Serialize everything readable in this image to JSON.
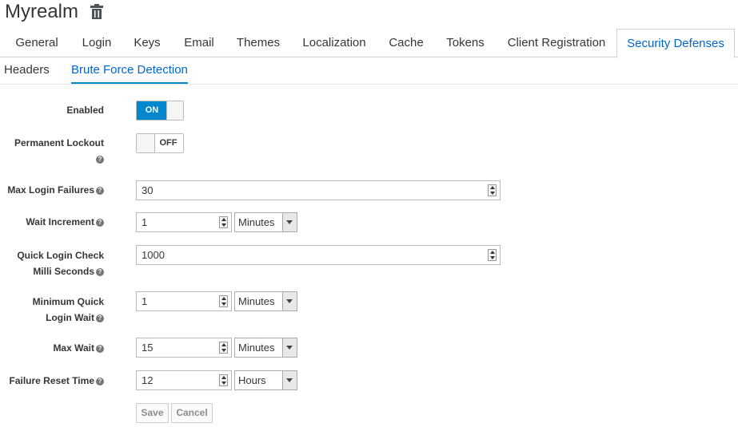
{
  "realm": {
    "title": "Myrealm",
    "delete_icon": "trash-icon"
  },
  "tabs": [
    {
      "label": "General"
    },
    {
      "label": "Login"
    },
    {
      "label": "Keys"
    },
    {
      "label": "Email"
    },
    {
      "label": "Themes"
    },
    {
      "label": "Localization"
    },
    {
      "label": "Cache"
    },
    {
      "label": "Tokens"
    },
    {
      "label": "Client Registration"
    },
    {
      "label": "Security Defenses",
      "active": true
    }
  ],
  "subtabs": [
    {
      "label": "Headers"
    },
    {
      "label": "Brute Force Detection",
      "active": true
    }
  ],
  "form": {
    "enabled": {
      "label": "Enabled",
      "state": "ON"
    },
    "permanent_lockout": {
      "label": "Permanent Lockout",
      "state": "OFF"
    },
    "max_login_failures": {
      "label": "Max Login Failures",
      "value": "30"
    },
    "wait_increment": {
      "label": "Wait Increment",
      "value": "1",
      "unit": "Minutes"
    },
    "quick_login_check": {
      "label_line1": "Quick Login Check",
      "label_line2": "Milli Seconds",
      "value": "1000"
    },
    "minimum_quick_login_wait": {
      "label_line1": "Minimum Quick",
      "label_line2": "Login Wait",
      "value": "1",
      "unit": "Minutes"
    },
    "max_wait": {
      "label": "Max Wait",
      "value": "15",
      "unit": "Minutes"
    },
    "failure_reset_time": {
      "label": "Failure Reset Time",
      "value": "12",
      "unit": "Hours"
    }
  },
  "buttons": {
    "save": "Save",
    "cancel": "Cancel"
  },
  "colors": {
    "accent": "#0088ce",
    "link": "#0066cc"
  }
}
